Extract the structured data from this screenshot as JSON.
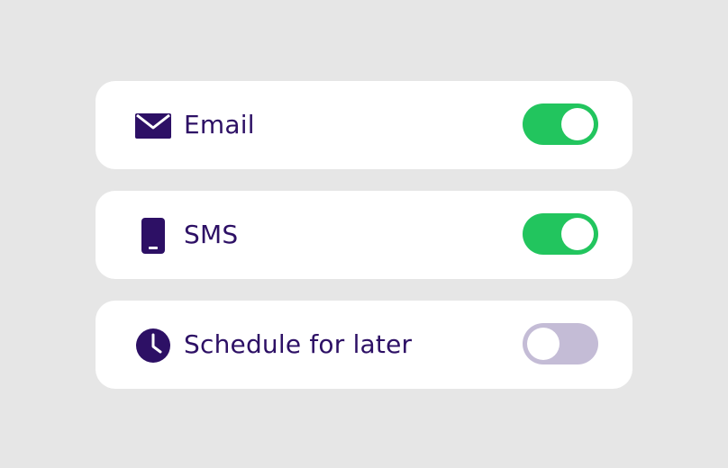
{
  "settings": [
    {
      "id": "email",
      "label": "Email",
      "icon": "envelope-icon",
      "enabled": true
    },
    {
      "id": "sms",
      "label": "SMS",
      "icon": "smartphone-icon",
      "enabled": true
    },
    {
      "id": "schedule",
      "label": "Schedule for later",
      "icon": "clock-icon",
      "enabled": false
    }
  ],
  "colors": {
    "background": "#e6e6e6",
    "card": "#ffffff",
    "text": "#2d1065",
    "toggle_on": "#22c55e",
    "toggle_off": "#c4bcd6"
  }
}
